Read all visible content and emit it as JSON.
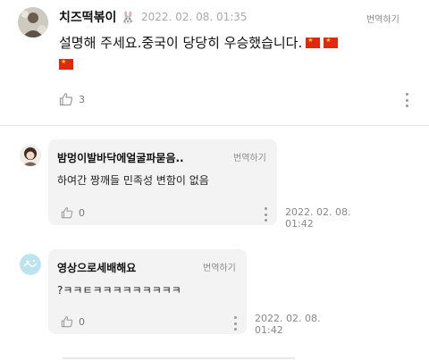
{
  "post": {
    "author": "치즈떡볶이",
    "author_emoji": "🐰",
    "time": "2022. 02. 08. 01:35",
    "translate_label": "번역하기",
    "text": "설명해 주세요.중국이 당당히 우승했습니다.",
    "flags": [
      "cn-flag",
      "cn-flag",
      "cn-flag"
    ],
    "likes": "3"
  },
  "replies": [
    {
      "author": "밤멍이발바닥에얼굴파묻음..",
      "translate_label": "번역하기",
      "text": "하여간 짱깨들 민족성 변함이 없음",
      "likes": "0",
      "time_date": "2022. 02. 08.",
      "time_clock": "01:42"
    },
    {
      "author": "영상으로세배해요",
      "translate_label": "번역하기",
      "text": "?ㅋㅋㅌㅋㅋㅋㅋㅋㅋㅋㅋㅋ",
      "likes": "0",
      "time_date": "2022. 02. 08.",
      "time_clock": "01:42"
    }
  ],
  "colors": {
    "bubble_bg": "#f3f3f3",
    "muted_text": "#aaaaaa",
    "divider": "#e5e5e5"
  },
  "icons": [
    "thumbs-up-icon",
    "more-vertical-icon",
    "cn-flag"
  ]
}
